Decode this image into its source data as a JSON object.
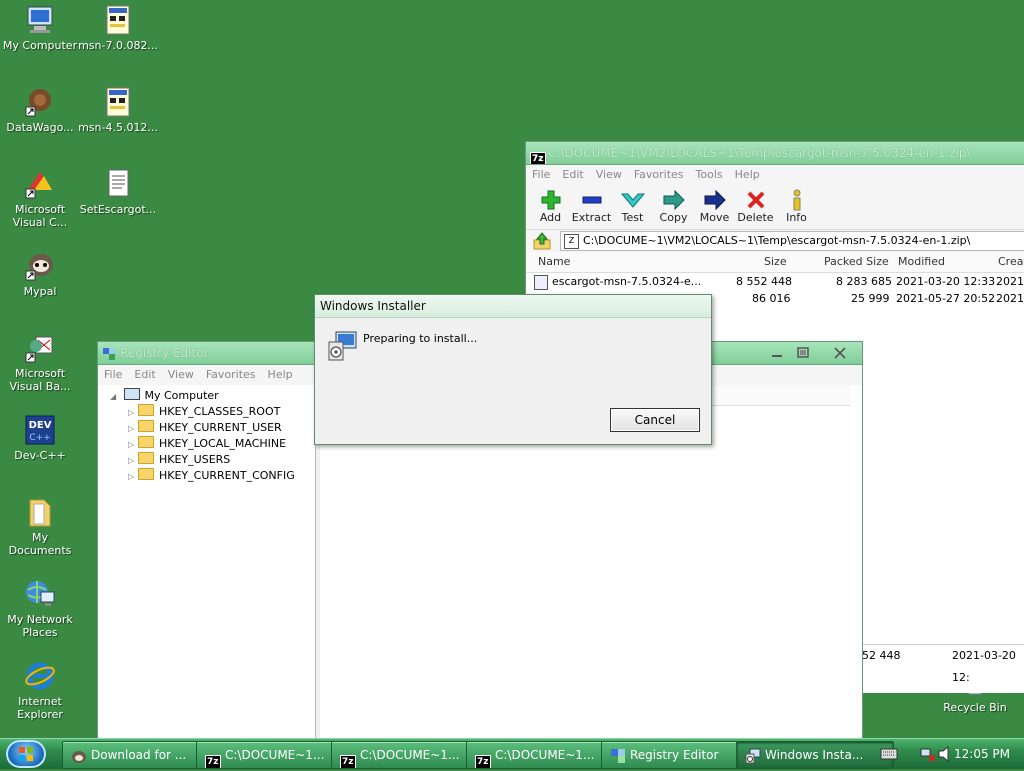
{
  "desktop": {
    "icons": [
      {
        "label": "My Computer"
      },
      {
        "label": "msn-7.0.082..."
      },
      {
        "label": "DataWago..."
      },
      {
        "label": "msn-4.5.012..."
      },
      {
        "label": "Microsoft\nVisual C..."
      },
      {
        "label": "SetEscargot..."
      },
      {
        "label": "Mypal"
      },
      {
        "label": "Microsoft\nVisual Ba..."
      },
      {
        "label": "Dev-C++"
      },
      {
        "label": "My\nDocuments"
      },
      {
        "label": "My Network\nPlaces"
      },
      {
        "label": "Internet\nExplorer"
      },
      {
        "label": "Recycle Bin"
      }
    ]
  },
  "sevenzip": {
    "title": "C:\\DOCUME~1\\VM2\\LOCALS~1\\Temp\\escargot-msn-7.5.0324-en-1.zip\\",
    "menu": [
      "File",
      "Edit",
      "View",
      "Favorites",
      "Tools",
      "Help"
    ],
    "toolbar": [
      "Add",
      "Extract",
      "Test",
      "Copy",
      "Move",
      "Delete",
      "Info"
    ],
    "address": "C:\\DOCUME~1\\VM2\\LOCALS~1\\Temp\\escargot-msn-7.5.0324-en-1.zip\\",
    "columns": [
      "Name",
      "Size",
      "Packed Size",
      "Modified",
      "Creat"
    ],
    "rows": [
      {
        "name": "escargot-msn-7.5.0324-e...",
        "size": "8 552 448",
        "packed": "8 283 685",
        "modified": "2021-03-20 12:33",
        "created": "2021-"
      },
      {
        "name": "",
        "size": "86 016",
        "packed": "25 999",
        "modified": "2021-05-27 20:52",
        "created": "2021-"
      }
    ],
    "status": {
      "size": "52 448",
      "modified": "2021-03-20 12:"
    }
  },
  "registry": {
    "title": "Registry Editor",
    "menu": [
      "File",
      "Edit",
      "View",
      "Favorites",
      "Help"
    ],
    "root": "My Computer",
    "keys": [
      "HKEY_CLASSES_ROOT",
      "HKEY_CURRENT_USER",
      "HKEY_LOCAL_MACHINE",
      "HKEY_USERS",
      "HKEY_CURRENT_CONFIG"
    ]
  },
  "installer": {
    "title": "Windows Installer",
    "message": "Preparing to install...",
    "cancel": "Cancel"
  },
  "taskbar": {
    "buttons": [
      {
        "label": "Download for ...",
        "icon": "browser-icon"
      },
      {
        "label": "C:\\DOCUME~1...",
        "icon": "7zip-icon"
      },
      {
        "label": "C:\\DOCUME~1...",
        "icon": "7zip-icon"
      },
      {
        "label": "C:\\DOCUME~1...",
        "icon": "7zip-icon"
      },
      {
        "label": "Registry Editor",
        "icon": "registry-icon"
      },
      {
        "label": "Windows Insta...",
        "icon": "installer-icon"
      }
    ],
    "clock": "12:05 PM"
  }
}
